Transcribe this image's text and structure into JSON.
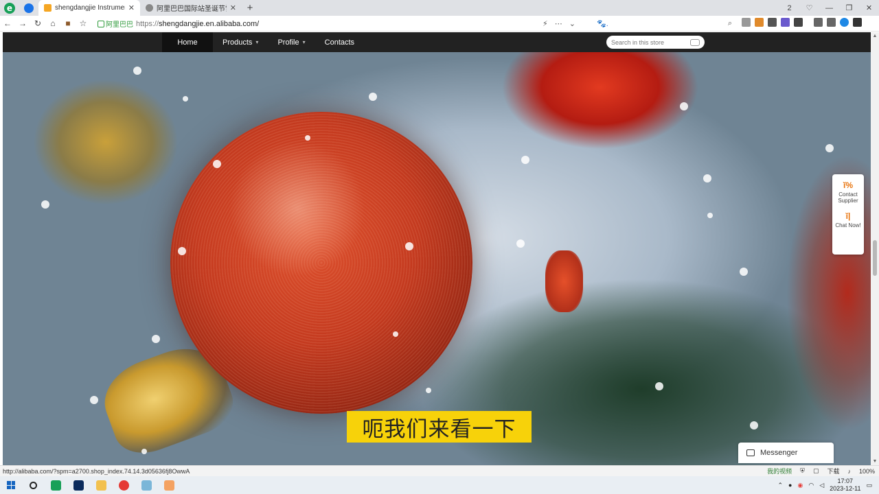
{
  "browser": {
    "tabs": [
      {
        "title": "shengdangjie Instrument C",
        "active": true,
        "favicon_color": "#f5a623"
      },
      {
        "title": "阿里巴巴国际站圣诞节雪花代",
        "active": false,
        "favicon_color": "#888888"
      }
    ],
    "new_tab": "+",
    "window_controls": [
      "2",
      "♡",
      "—",
      "❐",
      "✕"
    ],
    "nav": {
      "back": "←",
      "forward": "→",
      "reload": "↻",
      "home": "⌂",
      "favorite": "☆"
    },
    "site_label": "阿里巴巴",
    "url_protocol": "https://",
    "url_host": "shengdangjie.en.alibaba.com/",
    "url_right_icons": [
      "⚡",
      "⋯",
      "⌄"
    ],
    "search_hint": "🐾.",
    "search_icon": "⌕"
  },
  "store_nav": {
    "home": "Home",
    "products": "Products",
    "profile": "Profile",
    "contacts": "Contacts",
    "caret": "▾",
    "search_placeholder": "Search in this store"
  },
  "side_panel": {
    "contact_icon": "ĭ%",
    "contact_label": "Contact Supplier",
    "chat_icon": "ĭ|",
    "chat_label": "Chat Now!"
  },
  "subtitle": "呃我们来看一下",
  "messenger": {
    "label": "Messenger"
  },
  "status_bar": {
    "link": "http://alibaba.com/?spm=a2700.shop_index.74.14.3d05636fj8OwwA",
    "video": "我的视频",
    "download": "下载",
    "zoom": "100%"
  },
  "taskbar": {
    "time": "17:07",
    "date": "2023-12-11"
  },
  "colors": {
    "store_nav_bg": "#222222",
    "subtitle_bg": "#f7d20a",
    "accent_orange": "#e8730c"
  }
}
